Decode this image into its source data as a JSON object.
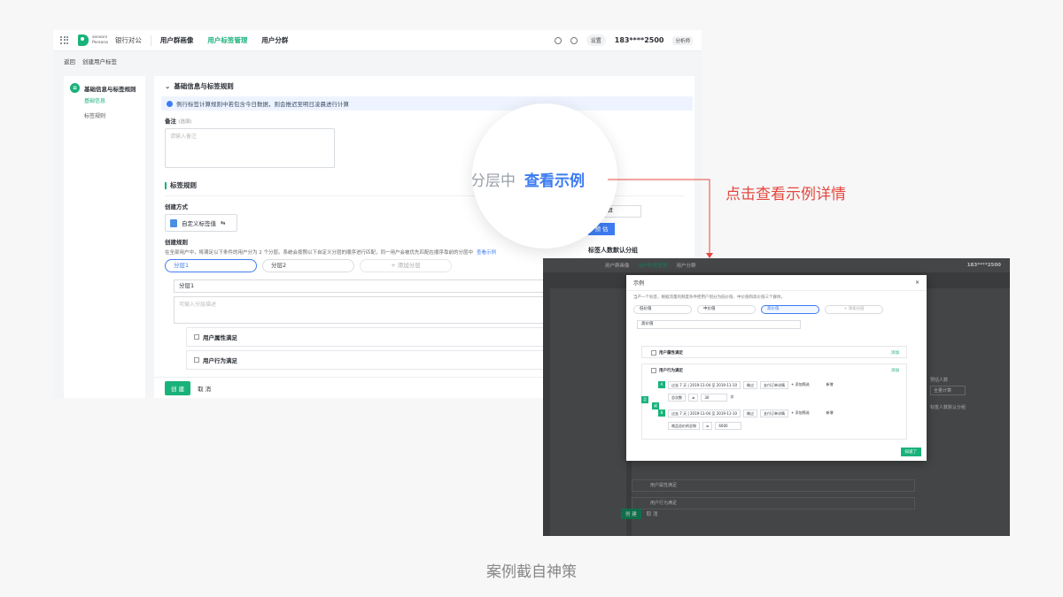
{
  "app": {
    "logo_text_1": "sensors",
    "logo_text_2": "Persona",
    "org": "银行对公",
    "nav": [
      "用户群画像",
      "用户标签管理",
      "用户分群"
    ],
    "settings": "设置",
    "phone": "183****2500",
    "role": "分析师",
    "back": "返回",
    "crumb": "创建用户标签",
    "sidebar": {
      "title": "基础信息与标签规则",
      "active_sub": "基础信息",
      "sub2": "标签规则"
    },
    "section_title": "基础信息与标签规则",
    "notice": "例行标签计算规则中若包含今日数据，则会推迟至明日凌晨进行计算",
    "remark_label": "备注",
    "remark_optional": "(选填)",
    "remark_placeholder": "请输入备注",
    "rule_section": "标签规则",
    "method_label": "创建方式",
    "method_value": "自定义标签值",
    "rule_label": "创建规则",
    "rule_desc": "在全部用户中，将满足以下条件的用户分为 2 个分层。系统会按照以下自定义分层的顺序进行匹配，同一用户会被优先匹配在顺序靠前的分层中",
    "rule_link": "查看示例",
    "layers": [
      "分层1",
      "分层2"
    ],
    "add_layer": "+ 添加分层",
    "layer_name": "分层1",
    "layer_desc_placeholder": "可输入分层描述",
    "cond1": "用户属性满足",
    "cond2": "用户行为满足",
    "create_btn": "创 建",
    "cancel_btn": "取 消",
    "right_label": "人数",
    "right_select": "全量计算",
    "right_btn": "预 估",
    "right_label2": "标签人数默认分组"
  },
  "zoom": {
    "grey_text": "分层中",
    "link_text": "查看示例"
  },
  "annotation": "点击查看示例详情",
  "modal": {
    "title": "示例",
    "intro": "当产一个标签，根据流量的频度条件把用户划分为低价值、中价值和高价值三个群体。",
    "pills": [
      "低价值",
      "中价值",
      "高价值"
    ],
    "add": "+ 添加分层",
    "name": "高价值",
    "attr": "用户属性满足",
    "behavior": "用户行为满足",
    "add_btn": "添加",
    "cond1": [
      "过去 7 天 | 2019-11-04 至 2019-11-10",
      "做过",
      "支付订单详情",
      "+ 添加筛选"
    ],
    "cond1b": [
      "总次数",
      "≥",
      "30",
      "次"
    ],
    "cond2": [
      "过去 7 天 | 2019-11-04 至 2019-11-10",
      "做过",
      "支付订单详情",
      "+ 添加筛选"
    ],
    "cond2b": [
      "商品总价的总和",
      "≥",
      "6000"
    ],
    "new": "新增",
    "tag_and": "且",
    "tag_or": "或",
    "tag_a": "A",
    "tag_b": "B",
    "footer_btn": "知道了"
  },
  "shot2": {
    "nav": [
      "用户群画像",
      "用户标签管理",
      "用户分群"
    ],
    "phone": "183****2500",
    "rule": "用户属性满足",
    "rule2": "用户行为满足",
    "create": "创 建",
    "cancel": "取 消",
    "right_label": "预估人数",
    "right_select": "全量计算",
    "right_label2": "标签人数默认分组"
  },
  "caption": "案例截自神策",
  "colors": {
    "brand_green": "#19b27a",
    "link_blue": "#3d7cf2",
    "annotation_red": "#e4483e"
  }
}
